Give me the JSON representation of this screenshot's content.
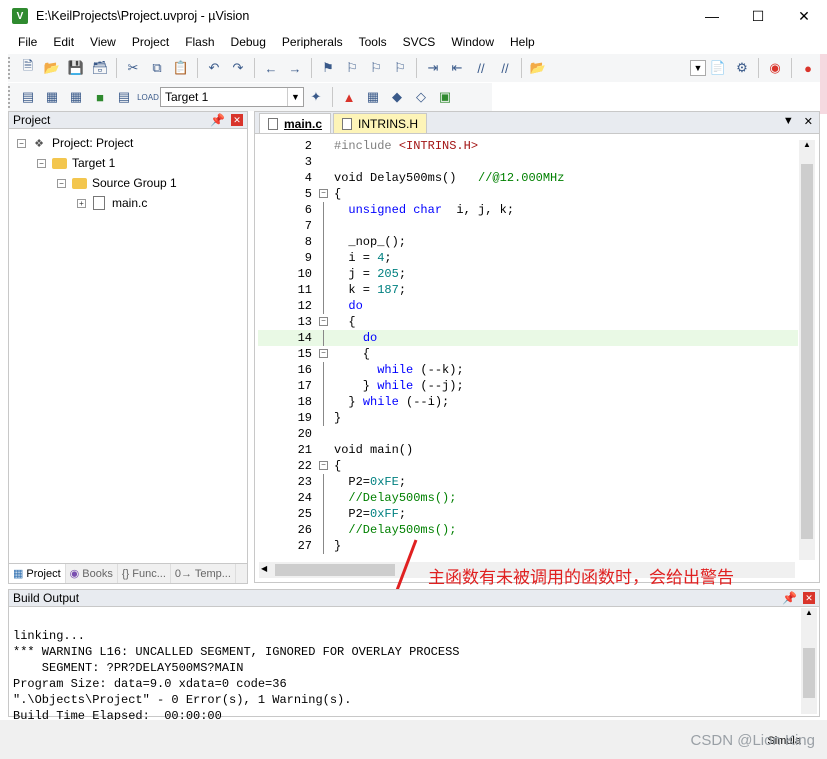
{
  "window": {
    "title": "E:\\KeilProjects\\Project.uvproj - µVision",
    "app_icon": "V"
  },
  "menu": [
    "File",
    "Edit",
    "View",
    "Project",
    "Flash",
    "Debug",
    "Peripherals",
    "Tools",
    "SVCS",
    "Window",
    "Help"
  ],
  "toolbar2": {
    "target": "Target 1"
  },
  "project_panel": {
    "title": "Project",
    "tree": {
      "root": "Project: Project",
      "target": "Target 1",
      "group": "Source Group 1",
      "file": "main.c"
    },
    "tabs": [
      "Project",
      "Books",
      "{} Func...",
      "0→ Temp..."
    ]
  },
  "editor": {
    "tabs": [
      {
        "label": "main.c"
      },
      {
        "label": "INTRINS.H"
      }
    ],
    "lines": [
      {
        "n": "2",
        "fold": "",
        "hl": false
      },
      {
        "n": "3",
        "fold": "",
        "hl": false
      },
      {
        "n": "4",
        "fold": "",
        "hl": false
      },
      {
        "n": "5",
        "fold": "box",
        "hl": false
      },
      {
        "n": "6",
        "fold": "line",
        "hl": false
      },
      {
        "n": "7",
        "fold": "line",
        "hl": false
      },
      {
        "n": "8",
        "fold": "line",
        "hl": false
      },
      {
        "n": "9",
        "fold": "line",
        "hl": false
      },
      {
        "n": "10",
        "fold": "line",
        "hl": false
      },
      {
        "n": "11",
        "fold": "line",
        "hl": false
      },
      {
        "n": "12",
        "fold": "line",
        "hl": false
      },
      {
        "n": "13",
        "fold": "box",
        "hl": false
      },
      {
        "n": "14",
        "fold": "line",
        "hl": true
      },
      {
        "n": "15",
        "fold": "box",
        "hl": false
      },
      {
        "n": "16",
        "fold": "line",
        "hl": false
      },
      {
        "n": "17",
        "fold": "line",
        "hl": false
      },
      {
        "n": "18",
        "fold": "line",
        "hl": false
      },
      {
        "n": "19",
        "fold": "line",
        "hl": false
      },
      {
        "n": "20",
        "fold": "",
        "hl": false
      },
      {
        "n": "21",
        "fold": "",
        "hl": false
      },
      {
        "n": "22",
        "fold": "box",
        "hl": false
      },
      {
        "n": "23",
        "fold": "line",
        "hl": false
      },
      {
        "n": "24",
        "fold": "line",
        "hl": false
      },
      {
        "n": "25",
        "fold": "line",
        "hl": false
      },
      {
        "n": "26",
        "fold": "line",
        "hl": false
      },
      {
        "n": "27",
        "fold": "line",
        "hl": false
      }
    ],
    "code": [
      [
        [
          "pp",
          "#include "
        ],
        [
          "str",
          "<INTRINS.H>"
        ]
      ],
      [],
      [
        [
          "",
          "void Delay500ms()   "
        ],
        [
          "cm",
          "//@12.000MHz"
        ]
      ],
      [
        [
          "",
          "{"
        ]
      ],
      [
        [
          "",
          "  "
        ],
        [
          "kw",
          "unsigned char"
        ],
        [
          "",
          "  i, j, k;"
        ]
      ],
      [],
      [
        [
          "",
          "  _nop_();"
        ]
      ],
      [
        [
          "",
          "  i = "
        ],
        [
          "num",
          "4"
        ],
        [
          "",
          ";"
        ]
      ],
      [
        [
          "",
          "  j = "
        ],
        [
          "num",
          "205"
        ],
        [
          "",
          ";"
        ]
      ],
      [
        [
          "",
          "  k = "
        ],
        [
          "num",
          "187"
        ],
        [
          "",
          ";"
        ]
      ],
      [
        [
          "",
          "  "
        ],
        [
          "kw",
          "do"
        ]
      ],
      [
        [
          "",
          "  {"
        ]
      ],
      [
        [
          "",
          "    "
        ],
        [
          "kw",
          "do"
        ]
      ],
      [
        [
          "",
          "    {"
        ]
      ],
      [
        [
          "",
          "      "
        ],
        [
          "kw",
          "while"
        ],
        [
          "",
          " (--k);"
        ]
      ],
      [
        [
          "",
          "    } "
        ],
        [
          "kw",
          "while"
        ],
        [
          "",
          " (--j);"
        ]
      ],
      [
        [
          "",
          "  } "
        ],
        [
          "kw",
          "while"
        ],
        [
          "",
          " (--i);"
        ]
      ],
      [
        [
          "",
          "}"
        ]
      ],
      [],
      [
        [
          "",
          "void main()"
        ]
      ],
      [
        [
          "",
          "{"
        ]
      ],
      [
        [
          "",
          "  P2="
        ],
        [
          "num",
          "0xFE"
        ],
        [
          "",
          ";"
        ]
      ],
      [
        [
          "",
          "  "
        ],
        [
          "cm",
          "//Delay500ms();"
        ]
      ],
      [
        [
          "",
          "  P2="
        ],
        [
          "num",
          "0xFF"
        ],
        [
          "",
          ";"
        ]
      ],
      [
        [
          "",
          "  "
        ],
        [
          "cm",
          "//Delay500ms();"
        ]
      ],
      [
        [
          "",
          "}"
        ]
      ]
    ]
  },
  "annotation": "主函数有未被调用的函数时，会给出警告",
  "build_output": {
    "title": "Build Output",
    "lines": [
      "linking...",
      "*** WARNING L16: UNCALLED SEGMENT, IGNORED FOR OVERLAY PROCESS",
      "    SEGMENT: ?PR?DELAY500MS?MAIN",
      "Program Size: data=9.0 xdata=0 code=36",
      "\".\\Objects\\Project\" - 0 Error(s), 1 Warning(s).",
      "Build Time Elapsed:  00:00:00"
    ]
  },
  "status": {
    "mode": "Simula"
  },
  "watermark": "CSDN @Lion King",
  "colors": {
    "keyword": "#0000ff",
    "number": "#008080",
    "comment": "#008000",
    "string": "#a31515",
    "annotation": "#e02020",
    "highlight": "#e9f9e5"
  }
}
